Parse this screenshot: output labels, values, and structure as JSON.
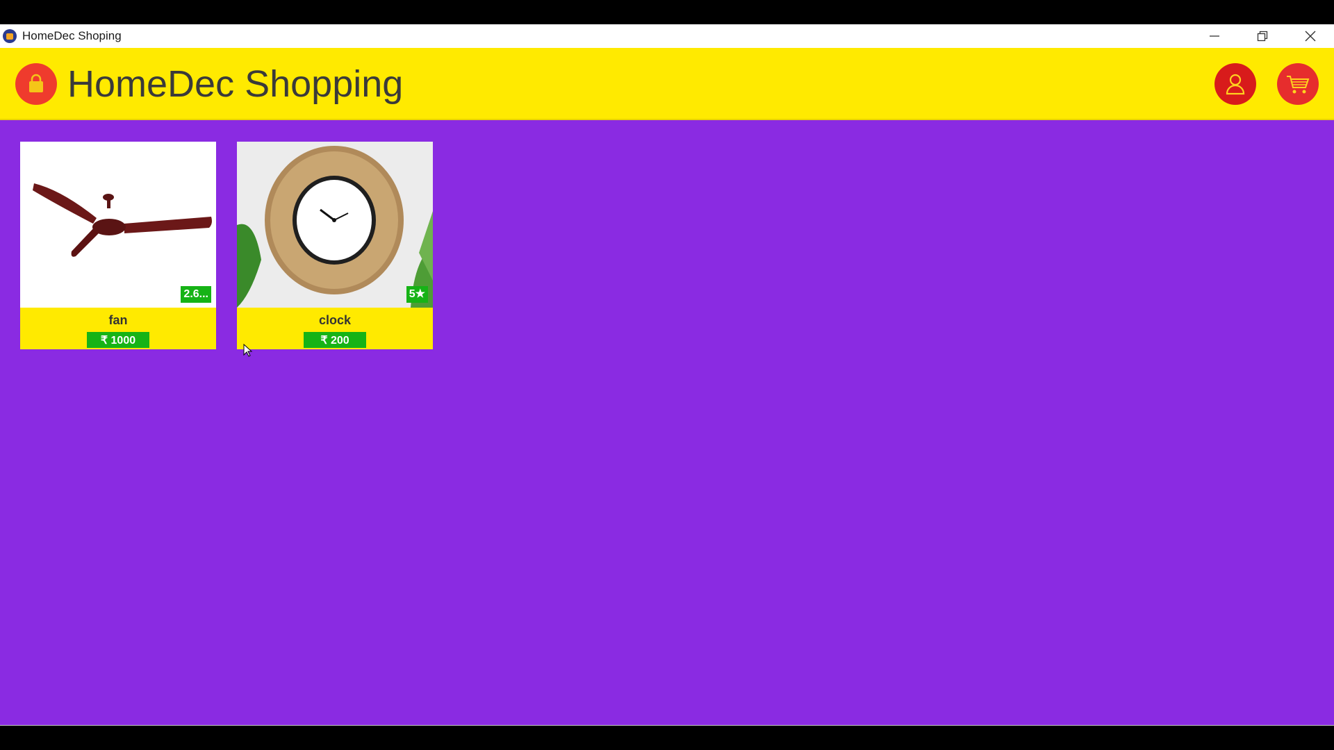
{
  "window": {
    "title": "HomeDec Shoping"
  },
  "header": {
    "app_title": "HomeDec Shopping",
    "logo_icon": "shopping-bag-icon",
    "profile_icon": "user-icon",
    "cart_icon": "cart-icon"
  },
  "colors": {
    "header_bg": "#ffea00",
    "content_bg": "#8a2be2",
    "icon_red": "#e62d2d",
    "badge_green": "#16b316"
  },
  "products": [
    {
      "name": "fan",
      "price": "₹ 1000",
      "rating": "2.6..."
    },
    {
      "name": "clock",
      "price": "₹ 200",
      "rating": "5★"
    }
  ]
}
